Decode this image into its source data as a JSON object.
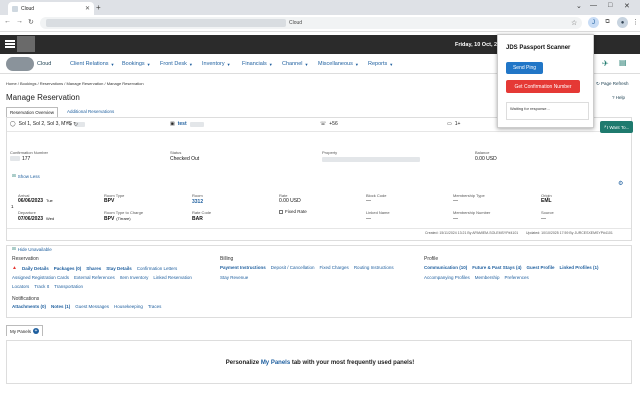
{
  "browser": {
    "tab_title": "Cloud",
    "url_suffix": "Cloud"
  },
  "header": {
    "date": "Friday, 10 Oct, 2025",
    "logo_text": "Cloud"
  },
  "menu": [
    {
      "label": "Client Relations",
      "has_caret": true
    },
    {
      "label": "Bookings",
      "has_caret": true
    },
    {
      "label": "Front Desk",
      "has_caret": true
    },
    {
      "label": "Inventory",
      "has_caret": true
    },
    {
      "label": "Financials",
      "has_caret": true
    },
    {
      "label": "Channel",
      "has_caret": true
    },
    {
      "label": "Miscellaneous",
      "has_caret": true
    },
    {
      "label": "Reports",
      "has_caret": true
    }
  ],
  "breadcrumb": "Home / Bookings / Reservations / Manage Reservation / Manage Reservation",
  "page_refresh": "Page Refresh",
  "help": "Help",
  "page_title": "Manage Reservation",
  "subtabs": [
    "Reservation Overview",
    "Additional Reservations"
  ],
  "guest": {
    "name_line": "Sol 1, Sol 2, Sol 3, MYS",
    "name_label": "test",
    "phone": "+56",
    "count": "1+"
  },
  "details": {
    "confirmation_label": "Confirmation Number",
    "confirmation_value": "177",
    "status_label": "Status",
    "status_value": "Checked Out",
    "property_label": "Property",
    "balance_label": "Balance",
    "balance_value": "0.00 USD"
  },
  "show_less": "Show Less",
  "stay": {
    "arrival_label": "Arrival",
    "arrival_value": "06/06/2023",
    "arrival_day": "Tue",
    "departure_label": "Departure",
    "departure_value": "07/06/2023",
    "departure_day": "Wed",
    "nights": "1",
    "room_type_label": "Room Type",
    "room_type_value": "BPV",
    "rtc_label": "Room Type to Charge",
    "rtc_value": "BPV",
    "rtc_extra": "(Tirrare)",
    "room_label": "Room",
    "room_value": "3312",
    "rate_code_label": "Rate Code",
    "rate_code_value": "BAR",
    "rate_label": "Rate",
    "rate_value": "0.00 USD",
    "fixed_rate": "Fixed Rate",
    "block_code_label": "Block Code",
    "block_code_value": "—",
    "linked_name_label": "Linked Name",
    "linked_name_value": "—",
    "membership_type_label": "Membership Type",
    "membership_type_value": "—",
    "membership_number_label": "Membership Number",
    "membership_number_value": "—",
    "origin_label": "Origin",
    "origin_value": "EML",
    "source_label": "Source",
    "source_value": "—"
  },
  "created_line": "Created: 15/11/2024 13:21 By APAMIEM-SOLEMSYP#4101",
  "updated_line": "Updated: 10/10/2025 17:59 By JURCESXEMSYP#4101",
  "hide_unavailable": "Hide Unavailable",
  "sections": {
    "reservation_title": "Reservation",
    "reservation_links_row1": [
      "Daily Details",
      "Packages (0)",
      "Shares",
      "Stay Details",
      "Confirmation Letters"
    ],
    "reservation_links_row2": [
      "Assigned Registration Cards",
      "External References",
      "Item Inventory",
      "Linked Reservation"
    ],
    "reservation_links_row3": [
      "Locators",
      "Track It",
      "Transportation"
    ],
    "billing_title": "Billing",
    "billing_links_row1": [
      "Payment Instructions",
      "Deposit / Cancellation",
      "Fixed Charges",
      "Routing Instructions"
    ],
    "billing_links_row2": [
      "Stay Revenue"
    ],
    "profile_title": "Profile",
    "profile_links_row1": [
      "Communication (10)",
      "Future & Past Stays (4)",
      "Guest Profile",
      "Linked Profiles (1)"
    ],
    "profile_links_row2": [
      "Accompanying Profiles",
      "Membership",
      "Preferences"
    ],
    "notifications_title": "Notifications",
    "notification_links": [
      "Attachments (0)",
      "Notes (1)",
      "Guest Messages",
      "Housekeeping",
      "Traces"
    ]
  },
  "my_panels": "My Panels",
  "panel_msg_pre": "Personalize ",
  "panel_msg_link": "My Panels",
  "panel_msg_post": " tab with your most frequently used panels!",
  "popup": {
    "title": "JDS Passport Scanner",
    "send_button": "Send Ping",
    "confirm_button": "Get Confirmation Number",
    "response_text": "Waiting for response..."
  },
  "i_want_to": "I Want To...",
  "colors": {
    "accent": "#1d5e9e",
    "send_btn": "#2176c7",
    "confirm_btn": "#e53935",
    "action_btn": "#1f7a6e"
  }
}
